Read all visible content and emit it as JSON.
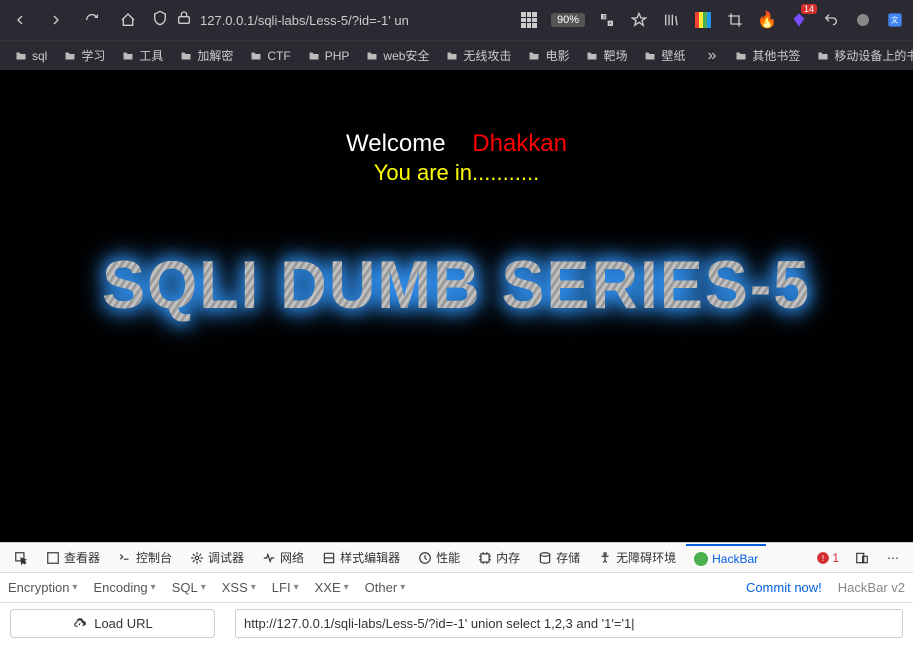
{
  "browser": {
    "url": "127.0.0.1/sqli-labs/Less-5/?id=-1' un",
    "zoom": "90%",
    "badge_count": "14"
  },
  "bookmarks": {
    "items": [
      {
        "label": "sql"
      },
      {
        "label": "学习"
      },
      {
        "label": "工具"
      },
      {
        "label": "加解密"
      },
      {
        "label": "CTF"
      },
      {
        "label": "PHP"
      },
      {
        "label": "web安全"
      },
      {
        "label": "无线攻击"
      },
      {
        "label": "电影"
      },
      {
        "label": "靶场"
      },
      {
        "label": "壁纸"
      }
    ],
    "other": "其他书签",
    "mobile": "移动设备上的书"
  },
  "page": {
    "welcome": "Welcome",
    "name_highlight": "Dhakkan",
    "you_are_in": "You are in...........",
    "big_title": "SQLI DUMB SERIES-5"
  },
  "devtools": {
    "tabs": [
      {
        "label": "查看器",
        "icon": "inspector"
      },
      {
        "label": "控制台",
        "icon": "console"
      },
      {
        "label": "调试器",
        "icon": "debugger"
      },
      {
        "label": "网络",
        "icon": "network"
      },
      {
        "label": "样式编辑器",
        "icon": "style"
      },
      {
        "label": "性能",
        "icon": "performance"
      },
      {
        "label": "内存",
        "icon": "memory"
      },
      {
        "label": "存储",
        "icon": "storage"
      },
      {
        "label": "无障碍环境",
        "icon": "accessibility"
      }
    ],
    "hackbar_label": "HackBar",
    "error_count": "1"
  },
  "hackbar": {
    "dropdowns": [
      "Encryption",
      "Encoding",
      "SQL",
      "XSS",
      "LFI",
      "XXE",
      "Other"
    ],
    "commit": "Commit now!",
    "version": "HackBar v2",
    "load_url_label": "Load URL",
    "url_value": "http://127.0.0.1/sqli-labs/Less-5/?id=-1' union select 1,2,3 and '1'='1|"
  }
}
